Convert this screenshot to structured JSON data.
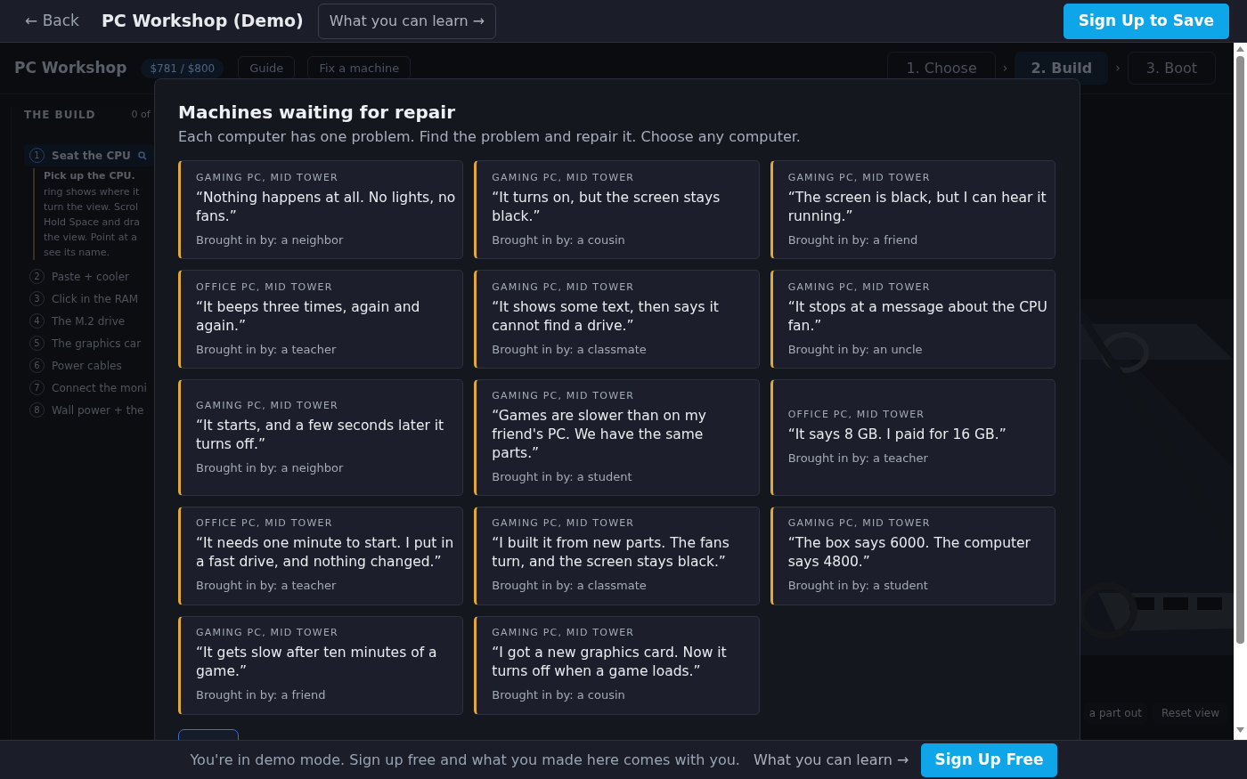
{
  "top_bar": {
    "back": "← Back",
    "title": "PC Workshop (Demo)",
    "learn_link": "What you can learn →",
    "signup": "Sign Up to Save"
  },
  "app": {
    "brand": "PC Workshop",
    "budget": "$781 / $800",
    "nav": [
      {
        "label": "Guide"
      },
      {
        "label": "Fix a machine"
      }
    ],
    "steps": [
      {
        "label": "1. Choose",
        "selected": false
      },
      {
        "label": "2. Build",
        "selected": true
      },
      {
        "label": "3. Boot",
        "selected": false
      }
    ],
    "step_separators": [
      "›",
      "›"
    ],
    "sidebar": {
      "heading": "THE BUILD",
      "progress": "0 of",
      "tasks": [
        {
          "number": "1",
          "title": "Seat the CPU",
          "active": true,
          "lead": "Pick up the CPU.",
          "lines": [
            "ring shows where it",
            "turn the view. Scrol",
            "Hold Space and dra",
            "the view. Point at a",
            "see its name."
          ]
        },
        {
          "number": "2",
          "title": "Paste + cooler",
          "active": false
        },
        {
          "number": "3",
          "title": "Click in the RAM",
          "active": false
        },
        {
          "number": "4",
          "title": "The M.2 drive",
          "active": false
        },
        {
          "number": "5",
          "title": "The graphics car",
          "active": false
        },
        {
          "number": "6",
          "title": "Power cables",
          "active": false
        },
        {
          "number": "7",
          "title": "Connect the moni",
          "active": false
        },
        {
          "number": "8",
          "title": "Wall power + the",
          "active": false
        }
      ]
    },
    "scene_controls": [
      "a part out",
      "Reset view"
    ]
  },
  "modal": {
    "title": "Machines waiting for repair",
    "subtitle": "Each computer has one problem. Find the problem and repair it. Choose any computer.",
    "machines": [
      {
        "category": "GAMING PC, MID TOWER",
        "complaint": "“Nothing happens at all. No lights, no fans.”",
        "brought_by": "Brought in by: a neighbor"
      },
      {
        "category": "GAMING PC, MID TOWER",
        "complaint": "“It turns on, but the screen stays black.”",
        "brought_by": "Brought in by: a cousin"
      },
      {
        "category": "GAMING PC, MID TOWER",
        "complaint": "“The screen is black, but I can hear it running.”",
        "brought_by": "Brought in by: a friend"
      },
      {
        "category": "OFFICE PC, MID TOWER",
        "complaint": "“It beeps three times, again and again.”",
        "brought_by": "Brought in by: a teacher"
      },
      {
        "category": "GAMING PC, MID TOWER",
        "complaint": "“It shows some text, then says it cannot find a drive.”",
        "brought_by": "Brought in by: a classmate"
      },
      {
        "category": "GAMING PC, MID TOWER",
        "complaint": "“It stops at a message about the CPU fan.”",
        "brought_by": "Brought in by: an uncle"
      },
      {
        "category": "GAMING PC, MID TOWER",
        "complaint": "“It starts, and a few seconds later it turns off.”",
        "brought_by": "Brought in by: a neighbor"
      },
      {
        "category": "GAMING PC, MID TOWER",
        "complaint": "“Games are slower than on my friend's PC. We have the same parts.”",
        "brought_by": "Brought in by: a student"
      },
      {
        "category": "OFFICE PC, MID TOWER",
        "complaint": "“It says 8 GB. I paid for 16 GB.”",
        "brought_by": "Brought in by: a teacher"
      },
      {
        "category": "OFFICE PC, MID TOWER",
        "complaint": "“It needs one minute to start. I put in a fast drive, and nothing changed.”",
        "brought_by": "Brought in by: a teacher"
      },
      {
        "category": "GAMING PC, MID TOWER",
        "complaint": "“I built it from new parts. The fans turn, and the screen stays black.”",
        "brought_by": "Brought in by: a classmate"
      },
      {
        "category": "GAMING PC, MID TOWER",
        "complaint": "“The box says 6000. The computer says 4800.”",
        "brought_by": "Brought in by: a student"
      },
      {
        "category": "GAMING PC, MID TOWER",
        "complaint": "“It gets slow after ten minutes of a game.”",
        "brought_by": "Brought in by: a friend"
      },
      {
        "category": "GAMING PC, MID TOWER",
        "complaint": "“I got a new graphics card. Now it turns off when a game loads.”",
        "brought_by": "Brought in by: a cousin"
      }
    ]
  },
  "bottom_bar": {
    "message": "You're in demo mode. Sign up free and what you made here comes with you.",
    "learn_link": "What you can learn →",
    "signup": "Sign Up Free"
  }
}
